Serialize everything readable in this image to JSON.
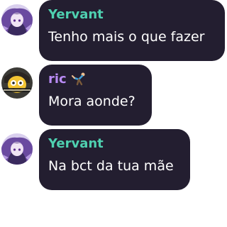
{
  "colors": {
    "bubble_background": "#231e30",
    "message_text": "#ffffff",
    "name_yervant": "#4fd0b0",
    "name_ric": "#b98bf5"
  },
  "messages": [
    {
      "author": "Yervant",
      "text": "Tenho mais o que fazer",
      "avatar_icon": "purple-anime-character-avatar"
    },
    {
      "author": "ric",
      "author_badge_icon": "gymnast-figure-icon",
      "text": "Mora aonde?",
      "avatar_icon": "yellow-cartoon-character-avatar"
    },
    {
      "author": "Yervant",
      "text": "Na bct da tua mãe",
      "avatar_icon": "purple-anime-character-avatar"
    }
  ]
}
